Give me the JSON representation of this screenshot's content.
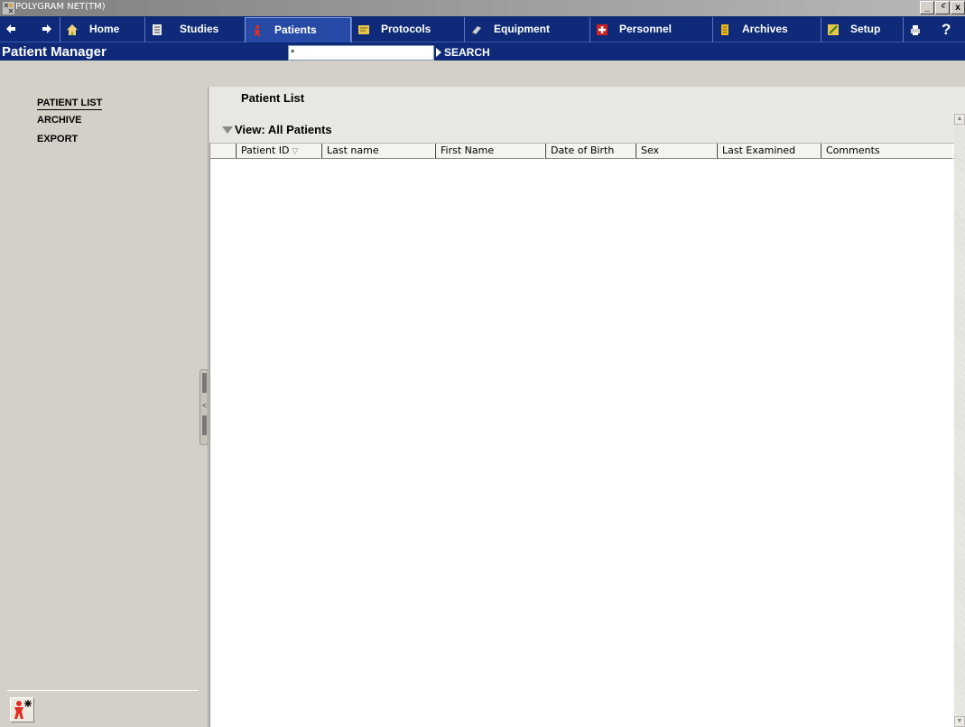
{
  "window": {
    "title": "POLYGRAM NET(TM)",
    "controls": [
      "_",
      "æ",
      "x"
    ]
  },
  "nav": {
    "back_icon": "back-arrow-icon",
    "forward_icon": "forward-arrow-icon",
    "tabs": [
      {
        "label": "Home",
        "icon": "home-icon"
      },
      {
        "label": "Studies",
        "icon": "studies-icon"
      },
      {
        "label": "Patients",
        "icon": "patient-icon",
        "active": true
      },
      {
        "label": "Protocols",
        "icon": "protocols-icon"
      },
      {
        "label": "Equipment",
        "icon": "equipment-icon"
      },
      {
        "label": "Personnel",
        "icon": "personnel-icon"
      },
      {
        "label": "Archives",
        "icon": "archives-icon"
      },
      {
        "label": "Setup",
        "icon": "setup-icon"
      }
    ],
    "print_icon": "print-icon",
    "help_label": "?"
  },
  "module": {
    "title": "Patient Manager",
    "search_value": "*",
    "search_label": "SEARCH"
  },
  "sidebar": {
    "items": [
      {
        "label": "PATIENT LIST",
        "active": true
      },
      {
        "label": "ARCHIVE"
      },
      {
        "label": "EXPORT"
      }
    ],
    "bottom_icon": "new-patient-icon"
  },
  "main": {
    "title": "Patient List",
    "view_label": "View: All Patients",
    "columns": [
      "Patient ID",
      "Last name",
      "First Name",
      "Date of Birth",
      "Sex",
      "Last Examined",
      "Comments"
    ],
    "sorted_column": "Patient ID",
    "rows": []
  },
  "colors": {
    "navbar": "#0e2a78",
    "active_tab": "#274aa6",
    "panel": "#d4d0c8"
  }
}
